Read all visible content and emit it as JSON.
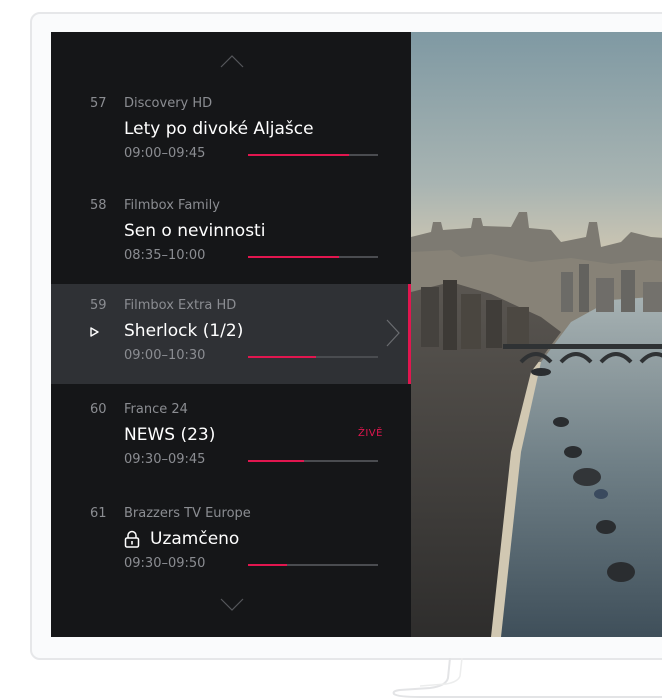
{
  "epg": {
    "channels": [
      {
        "number": "57",
        "name": "Discovery HD",
        "program": "Lety po divoké Aljašce",
        "time": "09:00–09:45",
        "progress": 0.78
      },
      {
        "number": "58",
        "name": "Filmbox Family",
        "program": "Sen o nevinnosti",
        "time": "08:35–10:00",
        "progress": 0.7
      },
      {
        "number": "59",
        "name": "Filmbox Extra HD",
        "program": "Sherlock (1/2)",
        "time": "09:00–10:30",
        "progress": 0.52,
        "selected": true,
        "playing": true
      },
      {
        "number": "60",
        "name": "France 24",
        "program": "NEWS (23)",
        "time": "09:30–09:45",
        "progress": 0.43,
        "badge": "ŽIVĚ"
      },
      {
        "number": "61",
        "name": "Brazzers TV Europe",
        "program": "Uzamčeno",
        "time": "09:30–09:50",
        "progress": 0.3,
        "locked": true
      }
    ]
  },
  "icons": {
    "scroll_up": "chevron-up-icon",
    "scroll_down": "chevron-down-icon",
    "play": "play-icon",
    "lock": "lock-icon",
    "open": "chevron-right-icon"
  },
  "colors": {
    "accent": "#e1164f",
    "panel": "#151618",
    "selected_row": "#2f3135",
    "muted_text": "#8b8d92"
  }
}
